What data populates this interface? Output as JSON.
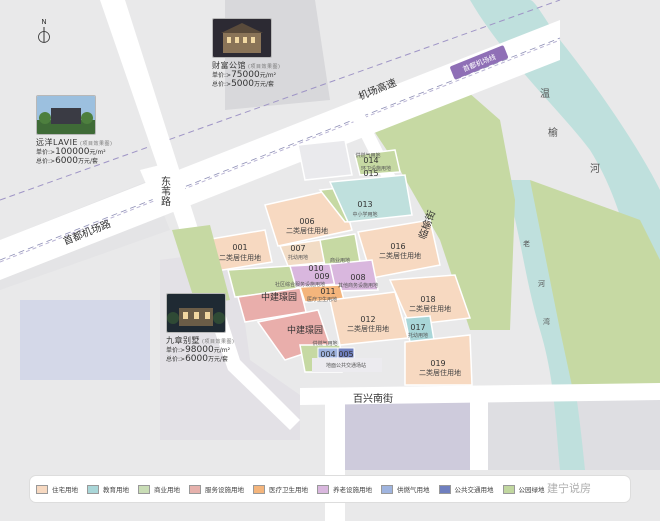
{
  "compass": {
    "label": "N"
  },
  "roads": {
    "airport_expressway": "机场高速",
    "airport_road": "首都机场路",
    "dongwei_road": "东苇路",
    "baixing_south_street": "百兴南街",
    "linheng_street": "临榆街",
    "airport_line_badge": "首都机场线"
  },
  "river": {
    "char1": "温",
    "char2": "榆",
    "char3": "河",
    "lao1": "老",
    "lao2": "河",
    "lao3": "湾"
  },
  "parcels": [
    {
      "id": "001",
      "use": "二类居住用地"
    },
    {
      "id": "006",
      "use": "二类居住用地"
    },
    {
      "id": "007",
      "use": "托幼用地"
    },
    {
      "id": "008",
      "use": "其他商务设施用地"
    },
    {
      "id": "009",
      "use": "社区综合服务设施用地"
    },
    {
      "id": "010",
      "use": "商业用地"
    },
    {
      "id": "011",
      "use": "医疗卫生用地"
    },
    {
      "id": "012",
      "use": "二类居住用地"
    },
    {
      "id": "013",
      "use": "中小学用地"
    },
    {
      "id": "014",
      "use": "供燃气用地"
    },
    {
      "id": "015",
      "use": "环卫设施用地"
    },
    {
      "id": "016",
      "use": "二类居住用地"
    },
    {
      "id": "017",
      "use": "托幼用地"
    },
    {
      "id": "018",
      "use": "二类居住用地"
    },
    {
      "id": "019",
      "use": "二类居住用地"
    },
    {
      "id": "004",
      "use": "供燃气用地"
    },
    {
      "id": "005",
      "use": "地面公共交通场站"
    }
  ],
  "zhongjian": {
    "upper": "中建璟园",
    "lower": "中建璟园"
  },
  "projects": [
    {
      "name": "财富公馆",
      "note": "(项目效果图)",
      "price_label": "单价:>",
      "price": "75000",
      "price_unit": "元/m²",
      "total_label": "总价:>",
      "total": "5000",
      "total_unit": "万元/套"
    },
    {
      "name": "远洋LAVIE",
      "note": "(项目效果图)",
      "price_label": "单价:>",
      "price": "100000",
      "price_unit": "元/m²",
      "total_label": "总价:>",
      "total": "6000",
      "total_unit": "万元/套"
    },
    {
      "name": "九章别墅",
      "note": "(项目效果图)",
      "price_label": "单价:>",
      "price": "98000",
      "price_unit": "元/m²",
      "total_label": "总价:>",
      "total": "6000",
      "total_unit": "万元/套"
    }
  ],
  "legend": [
    {
      "label": "住宅用地",
      "color": "#f7d9c1"
    },
    {
      "label": "教育用地",
      "color": "#a9d6d8"
    },
    {
      "label": "商业用地",
      "color": "#c9ddb6"
    },
    {
      "label": "服务设施用地",
      "color": "#e6b1ac"
    },
    {
      "label": "医疗卫生用地",
      "color": "#f4b57c"
    },
    {
      "label": "养老设施用地",
      "color": "#d9b7de"
    },
    {
      "label": "供燃气用地",
      "color": "#9fb4df"
    },
    {
      "label": "公共交通用地",
      "color": "#6f7fbf"
    },
    {
      "label": "公园绿地",
      "color": "#c1d79f"
    }
  ],
  "watermark": "建宁说房",
  "colors": {
    "residential": "#f7d9c1",
    "green": "#c6d9a3",
    "river": "#bfe0dd",
    "road": "#ffffff",
    "block": "#d6d6d9",
    "dark_block": "#cfcdd9",
    "pink_service": "#e9aeab",
    "purple_badge": "#8f6fb6"
  }
}
